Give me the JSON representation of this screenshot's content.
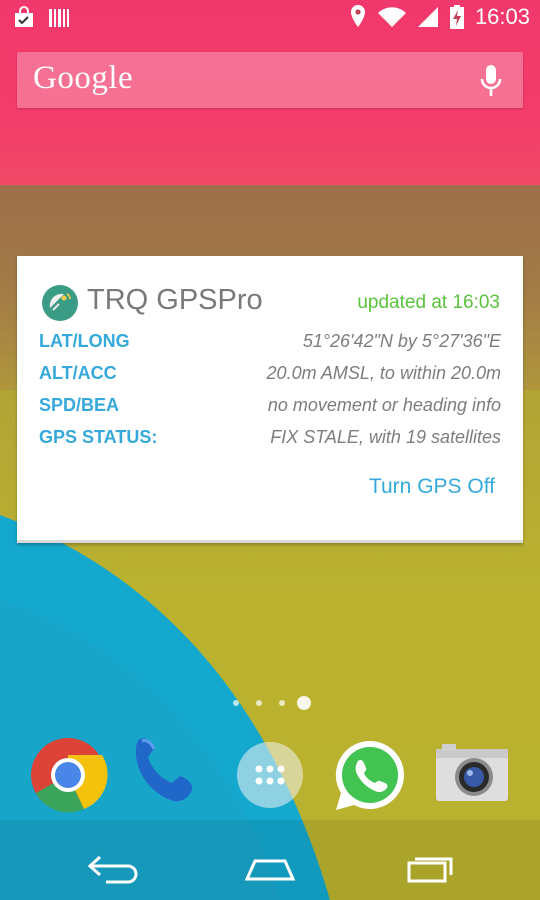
{
  "status_bar": {
    "time": "16:03",
    "left_icons": [
      "shopping-bag-check-icon",
      "barcode-icon"
    ],
    "right_icons": [
      "location-pin-icon",
      "wifi-icon",
      "signal-icon",
      "battery-charging-icon"
    ]
  },
  "search_bar": {
    "logo_text": "Google",
    "mic_icon": "microphone-icon"
  },
  "widget": {
    "app_name": "TRQ GPSPro",
    "updated": "updated at 16:03",
    "rows": [
      {
        "label": "LAT/LONG",
        "value": "51°26'42\"N by 5°27'36\"E"
      },
      {
        "label": "ALT/ACC",
        "value": "20.0m AMSL, to within 20.0m"
      },
      {
        "label": "SPD/BEA",
        "value": "no movement or heading info"
      },
      {
        "label": "GPS STATUS:",
        "value": "FIX STALE, with 19 satellites"
      }
    ],
    "toggle_label": "Turn GPS Off",
    "colors": {
      "label": "#35a9dc",
      "updated": "#5ac33c",
      "value": "#7d7d7d"
    }
  },
  "page_indicator": {
    "count": 4,
    "active_index": 3
  },
  "dock": {
    "apps": [
      "chrome-icon",
      "phone-icon",
      "app-drawer-icon",
      "whatsapp-icon",
      "camera-icon"
    ]
  },
  "nav_bar": {
    "buttons": [
      "back-icon",
      "home-icon",
      "recents-icon"
    ]
  }
}
